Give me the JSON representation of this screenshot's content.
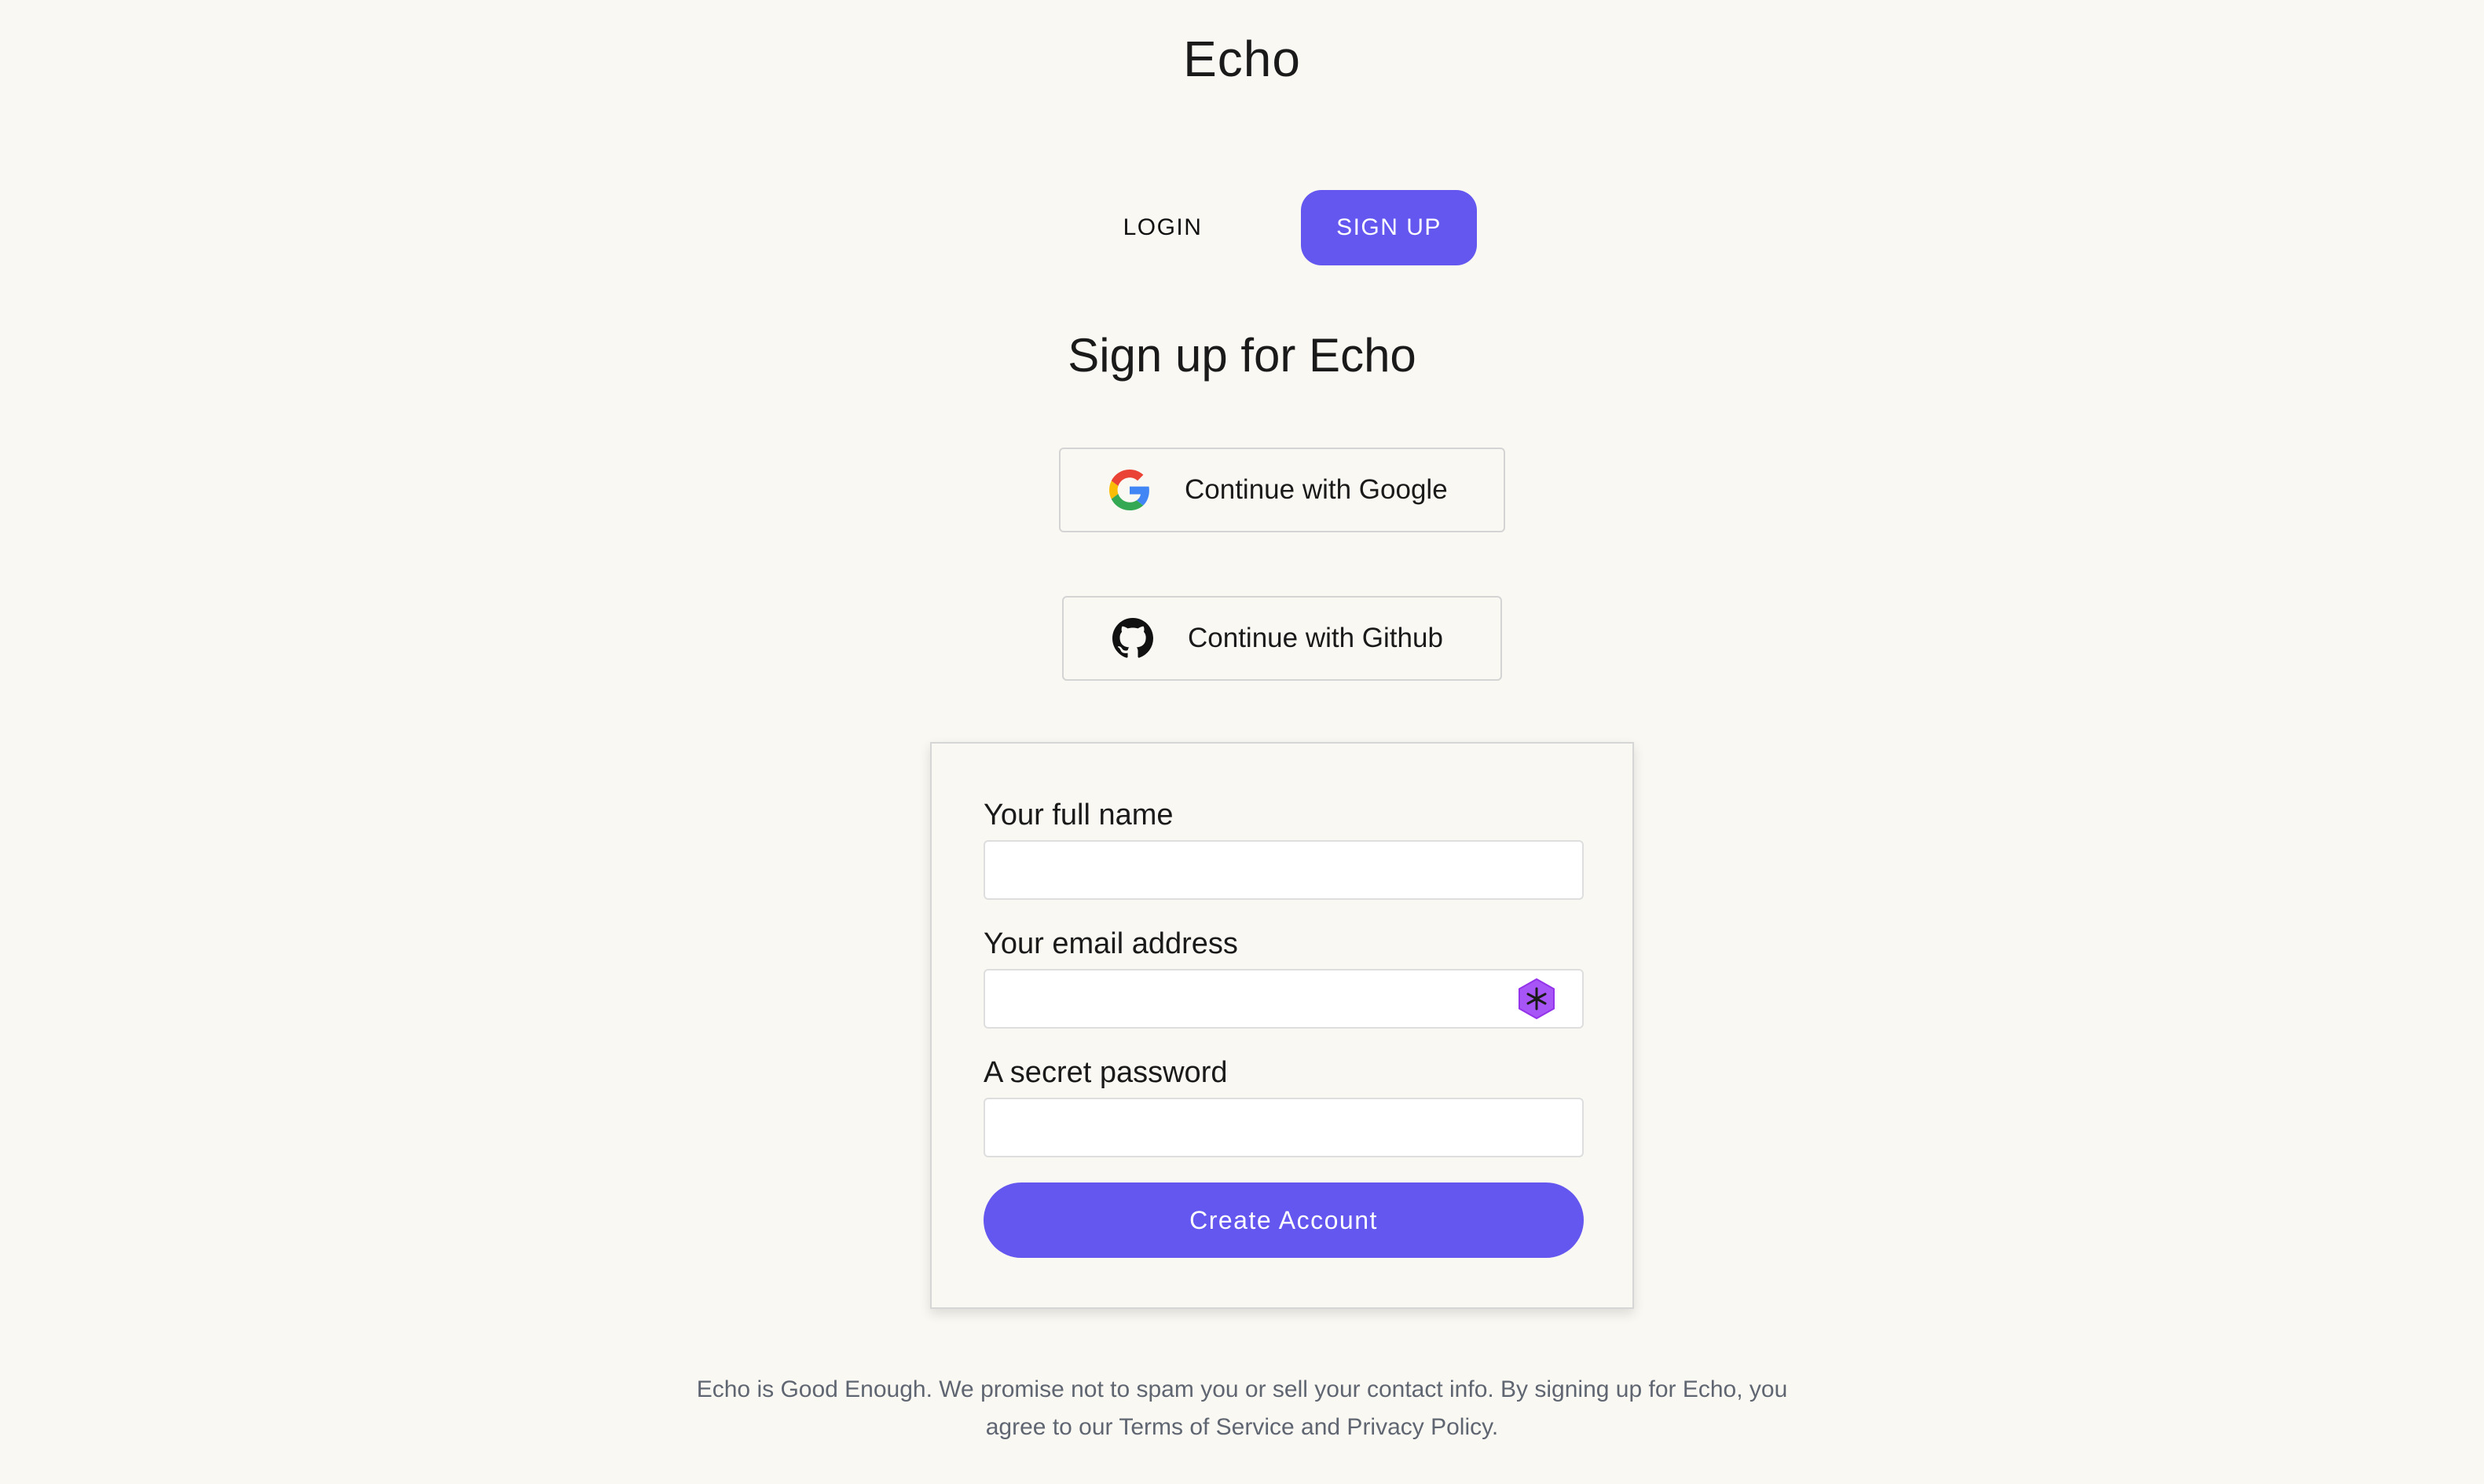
{
  "app": {
    "title": "Echo"
  },
  "tabs": {
    "login_label": "LOGIN",
    "signup_label": "SIGN UP",
    "active": "SIGN UP"
  },
  "heading": "Sign up for Echo",
  "oauth": {
    "google_label": "Continue with Google",
    "github_label": "Continue with Github",
    "google_icon": "google-icon",
    "github_icon": "github-icon"
  },
  "form": {
    "name_label": "Your full name",
    "name_value": "",
    "email_label": "Your email address",
    "email_value": "",
    "email_extension_icon": "password-manager-extension-icon",
    "password_label": "A secret password",
    "password_value": "",
    "submit_label": "Create Account"
  },
  "footer": {
    "line1": "Echo is Good Enough. We promise not to spam you or sell your contact info. By signing up for Echo, you",
    "line2": "agree to our Terms of Service and Privacy Policy."
  },
  "colors": {
    "background": "#faf8f2",
    "accent": "#6457f0",
    "footer_text": "#5f6672",
    "extension_icon": "#a855f7"
  }
}
